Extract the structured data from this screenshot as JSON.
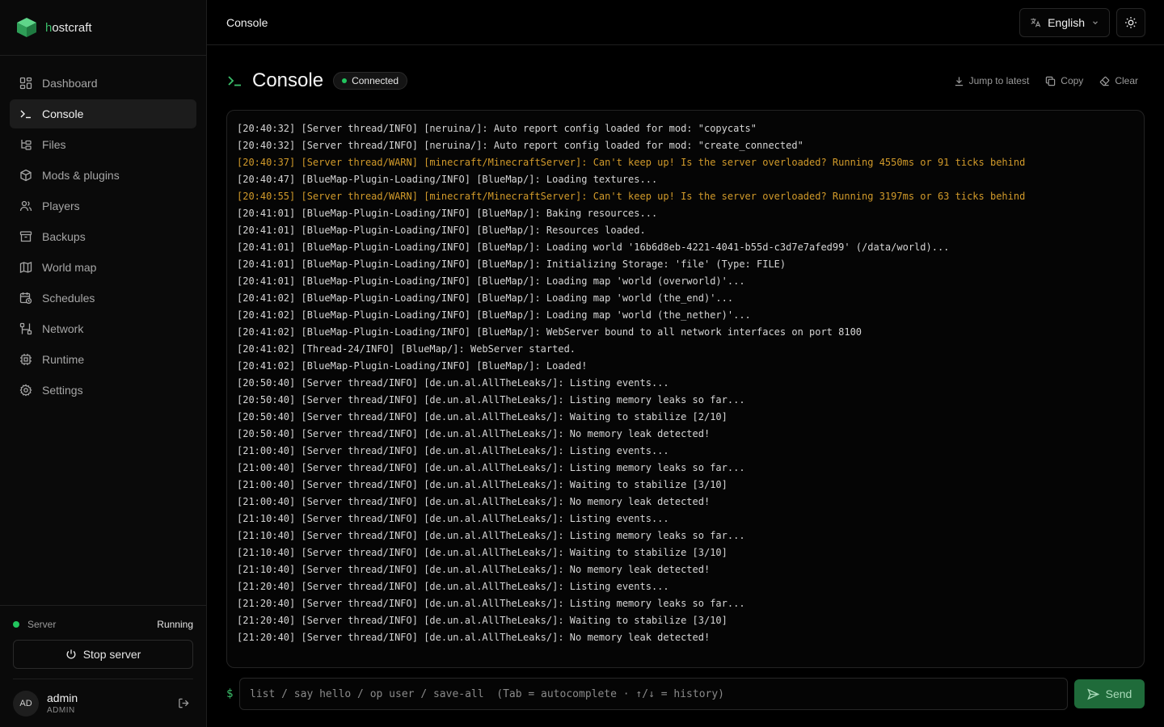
{
  "brand": {
    "first_letter": "h",
    "rest": "ostcraft"
  },
  "sidebar": {
    "items": [
      {
        "label": "Dashboard",
        "icon": "dashboard-icon"
      },
      {
        "label": "Console",
        "icon": "terminal-icon"
      },
      {
        "label": "Files",
        "icon": "folder-tree-icon"
      },
      {
        "label": "Mods & plugins",
        "icon": "package-icon"
      },
      {
        "label": "Players",
        "icon": "users-icon"
      },
      {
        "label": "Backups",
        "icon": "archive-icon"
      },
      {
        "label": "World map",
        "icon": "map-icon"
      },
      {
        "label": "Schedules",
        "icon": "calendar-clock-icon"
      },
      {
        "label": "Network",
        "icon": "network-icon"
      },
      {
        "label": "Runtime",
        "icon": "cpu-icon"
      },
      {
        "label": "Settings",
        "icon": "gear-icon"
      }
    ],
    "active_index": 1
  },
  "server": {
    "label": "Server",
    "status": "Running",
    "stop_label": "Stop server"
  },
  "user": {
    "initials": "AD",
    "name": "admin",
    "role": "ADMIN"
  },
  "topbar": {
    "breadcrumb": "Console",
    "language": "English"
  },
  "console": {
    "title": "Console",
    "badge": "Connected",
    "jump_label": "Jump to latest",
    "copy_label": "Copy",
    "clear_label": "Clear",
    "lines": [
      {
        "text": "[20:40:32] [Server thread/INFO] [neruina/]: Auto report config loaded for mod: \"copycats\"",
        "level": "info"
      },
      {
        "text": "[20:40:32] [Server thread/INFO] [neruina/]: Auto report config loaded for mod: \"create_connected\"",
        "level": "info"
      },
      {
        "text": "[20:40:37] [Server thread/WARN] [minecraft/MinecraftServer]: Can't keep up! Is the server overloaded? Running 4550ms or 91 ticks behind",
        "level": "warn"
      },
      {
        "text": "[20:40:47] [BlueMap-Plugin-Loading/INFO] [BlueMap/]: Loading textures...",
        "level": "info"
      },
      {
        "text": "[20:40:55] [Server thread/WARN] [minecraft/MinecraftServer]: Can't keep up! Is the server overloaded? Running 3197ms or 63 ticks behind",
        "level": "warn"
      },
      {
        "text": "[20:41:01] [BlueMap-Plugin-Loading/INFO] [BlueMap/]: Baking resources...",
        "level": "info"
      },
      {
        "text": "[20:41:01] [BlueMap-Plugin-Loading/INFO] [BlueMap/]: Resources loaded.",
        "level": "info"
      },
      {
        "text": "[20:41:01] [BlueMap-Plugin-Loading/INFO] [BlueMap/]: Loading world '16b6d8eb-4221-4041-b55d-c3d7e7afed99' (/data/world)...",
        "level": "info"
      },
      {
        "text": "[20:41:01] [BlueMap-Plugin-Loading/INFO] [BlueMap/]: Initializing Storage: 'file' (Type: FILE)",
        "level": "info"
      },
      {
        "text": "[20:41:01] [BlueMap-Plugin-Loading/INFO] [BlueMap/]: Loading map 'world (overworld)'...",
        "level": "info"
      },
      {
        "text": "[20:41:02] [BlueMap-Plugin-Loading/INFO] [BlueMap/]: Loading map 'world (the_end)'...",
        "level": "info"
      },
      {
        "text": "[20:41:02] [BlueMap-Plugin-Loading/INFO] [BlueMap/]: Loading map 'world (the_nether)'...",
        "level": "info"
      },
      {
        "text": "[20:41:02] [BlueMap-Plugin-Loading/INFO] [BlueMap/]: WebServer bound to all network interfaces on port 8100",
        "level": "info"
      },
      {
        "text": "[20:41:02] [Thread-24/INFO] [BlueMap/]: WebServer started.",
        "level": "info"
      },
      {
        "text": "[20:41:02] [BlueMap-Plugin-Loading/INFO] [BlueMap/]: Loaded!",
        "level": "info"
      },
      {
        "text": "[20:50:40] [Server thread/INFO] [de.un.al.AllTheLeaks/]: Listing events...",
        "level": "info"
      },
      {
        "text": "[20:50:40] [Server thread/INFO] [de.un.al.AllTheLeaks/]: Listing memory leaks so far...",
        "level": "info"
      },
      {
        "text": "[20:50:40] [Server thread/INFO] [de.un.al.AllTheLeaks/]: Waiting to stabilize [2/10]",
        "level": "info"
      },
      {
        "text": "[20:50:40] [Server thread/INFO] [de.un.al.AllTheLeaks/]: No memory leak detected!",
        "level": "info"
      },
      {
        "text": "[21:00:40] [Server thread/INFO] [de.un.al.AllTheLeaks/]: Listing events...",
        "level": "info"
      },
      {
        "text": "[21:00:40] [Server thread/INFO] [de.un.al.AllTheLeaks/]: Listing memory leaks so far...",
        "level": "info"
      },
      {
        "text": "[21:00:40] [Server thread/INFO] [de.un.al.AllTheLeaks/]: Waiting to stabilize [3/10]",
        "level": "info"
      },
      {
        "text": "[21:00:40] [Server thread/INFO] [de.un.al.AllTheLeaks/]: No memory leak detected!",
        "level": "info"
      },
      {
        "text": "[21:10:40] [Server thread/INFO] [de.un.al.AllTheLeaks/]: Listing events...",
        "level": "info"
      },
      {
        "text": "[21:10:40] [Server thread/INFO] [de.un.al.AllTheLeaks/]: Listing memory leaks so far...",
        "level": "info"
      },
      {
        "text": "[21:10:40] [Server thread/INFO] [de.un.al.AllTheLeaks/]: Waiting to stabilize [3/10]",
        "level": "info"
      },
      {
        "text": "[21:10:40] [Server thread/INFO] [de.un.al.AllTheLeaks/]: No memory leak detected!",
        "level": "info"
      },
      {
        "text": "[21:20:40] [Server thread/INFO] [de.un.al.AllTheLeaks/]: Listing events...",
        "level": "info"
      },
      {
        "text": "[21:20:40] [Server thread/INFO] [de.un.al.AllTheLeaks/]: Listing memory leaks so far...",
        "level": "info"
      },
      {
        "text": "[21:20:40] [Server thread/INFO] [de.un.al.AllTheLeaks/]: Waiting to stabilize [3/10]",
        "level": "info"
      },
      {
        "text": "[21:20:40] [Server thread/INFO] [de.un.al.AllTheLeaks/]: No memory leak detected!",
        "level": "info"
      }
    ],
    "prompt": "$",
    "input_placeholder": "list / say hello / op user / save-all  (Tab = autocomplete · ↑/↓ = history)",
    "input_value": "",
    "send_label": "Send"
  },
  "colors": {
    "accent": "#3bbf6a",
    "warn": "#d19a2a",
    "running": "#22c55e",
    "send_bg": "#1f6b3a"
  }
}
